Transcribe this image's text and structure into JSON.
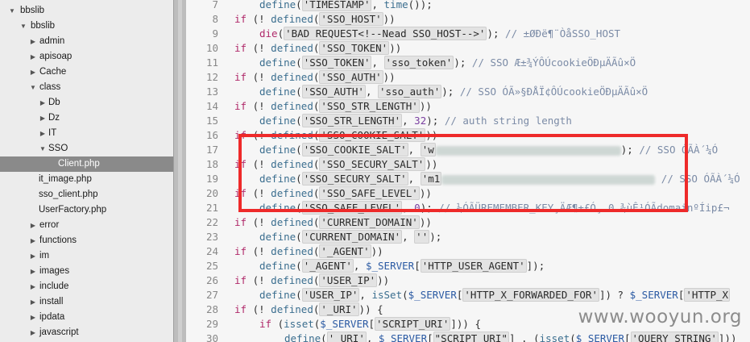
{
  "tree": [
    {
      "label": "bbslib",
      "level": 0,
      "expanded": true
    },
    {
      "label": "bbslib",
      "level": 1,
      "expanded": true
    },
    {
      "label": "admin",
      "level": 2,
      "expanded": false
    },
    {
      "label": "apisoap",
      "level": 2,
      "expanded": false
    },
    {
      "label": "Cache",
      "level": 2,
      "expanded": false
    },
    {
      "label": "class",
      "level": 2,
      "expanded": true
    },
    {
      "label": "Db",
      "level": 3,
      "expanded": false
    },
    {
      "label": "Dz",
      "level": 3,
      "expanded": false
    },
    {
      "label": "IT",
      "level": 3,
      "expanded": false
    },
    {
      "label": "SSO",
      "level": 3,
      "expanded": true
    },
    {
      "label": "Client.php",
      "level": 4,
      "file": true,
      "selected": true
    },
    {
      "label": "it_image.php",
      "level": 3,
      "file": true
    },
    {
      "label": "sso_client.php",
      "level": 3,
      "file": true
    },
    {
      "label": "UserFactory.php",
      "level": 3,
      "file": true
    },
    {
      "label": "error",
      "level": 2,
      "expanded": false
    },
    {
      "label": "functions",
      "level": 2,
      "expanded": false
    },
    {
      "label": "im",
      "level": 2,
      "expanded": false
    },
    {
      "label": "images",
      "level": 2,
      "expanded": false
    },
    {
      "label": "include",
      "level": 2,
      "expanded": false
    },
    {
      "label": "install",
      "level": 2,
      "expanded": false
    },
    {
      "label": "ipdata",
      "level": 2,
      "expanded": false
    },
    {
      "label": "javascript",
      "level": 2,
      "expanded": false
    }
  ],
  "code": [
    {
      "n": "7",
      "indent": 1,
      "tokens": [
        [
          "fn",
          "define"
        ],
        [
          "plain",
          "("
        ],
        [
          "str",
          "'TIMESTAMP'"
        ],
        [
          "plain",
          ", "
        ],
        [
          "fn",
          "time"
        ],
        [
          "plain",
          "());"
        ]
      ]
    },
    {
      "n": "8",
      "indent": 0,
      "tokens": [
        [
          "kw",
          "if"
        ],
        [
          "plain",
          " (! "
        ],
        [
          "fn",
          "defined"
        ],
        [
          "plain",
          "("
        ],
        [
          "str",
          "'SSO_HOST'"
        ],
        [
          "plain",
          "))"
        ]
      ]
    },
    {
      "n": "9",
      "indent": 1,
      "tokens": [
        [
          "kw",
          "die"
        ],
        [
          "plain",
          "("
        ],
        [
          "str",
          "'BAD REQUEST<!--Nead SSO_HOST-->'"
        ],
        [
          "plain",
          "); "
        ],
        [
          "cmt",
          "// ±ØÐë¶¨ÒåSSO_HOST"
        ]
      ]
    },
    {
      "n": "10",
      "indent": 0,
      "tokens": [
        [
          "kw",
          "if"
        ],
        [
          "plain",
          " (! "
        ],
        [
          "fn",
          "defined"
        ],
        [
          "plain",
          "("
        ],
        [
          "str",
          "'SSO_TOKEN'"
        ],
        [
          "plain",
          "))"
        ]
      ]
    },
    {
      "n": "11",
      "indent": 1,
      "tokens": [
        [
          "fn",
          "define"
        ],
        [
          "plain",
          "("
        ],
        [
          "str",
          "'SSO_TOKEN'"
        ],
        [
          "plain",
          ", "
        ],
        [
          "str",
          "'sso_token'"
        ],
        [
          "plain",
          "); "
        ],
        [
          "cmt",
          "// SSO Æ±¾ÝÔÚcookieÖÐµÄÃû×Ö"
        ]
      ]
    },
    {
      "n": "12",
      "indent": 0,
      "tokens": [
        [
          "kw",
          "if"
        ],
        [
          "plain",
          " (! "
        ],
        [
          "fn",
          "defined"
        ],
        [
          "plain",
          "("
        ],
        [
          "str",
          "'SSO_AUTH'"
        ],
        [
          "plain",
          "))"
        ]
      ]
    },
    {
      "n": "13",
      "indent": 1,
      "tokens": [
        [
          "fn",
          "define"
        ],
        [
          "plain",
          "("
        ],
        [
          "str",
          "'SSO_AUTH'"
        ],
        [
          "plain",
          ", "
        ],
        [
          "str",
          "'sso_auth'"
        ],
        [
          "plain",
          "); "
        ],
        [
          "cmt",
          "// SSO ÓÃ»§ÐÅÏ¢ÔÚcookieÖÐµÄÃû×Ö"
        ]
      ]
    },
    {
      "n": "14",
      "indent": 0,
      "tokens": [
        [
          "kw",
          "if"
        ],
        [
          "plain",
          " (! "
        ],
        [
          "fn",
          "defined"
        ],
        [
          "plain",
          "("
        ],
        [
          "str",
          "'SSO_STR_LENGTH'"
        ],
        [
          "plain",
          "))"
        ]
      ]
    },
    {
      "n": "15",
      "indent": 1,
      "tokens": [
        [
          "fn",
          "define"
        ],
        [
          "plain",
          "("
        ],
        [
          "str",
          "'SSO_STR_LENGTH'"
        ],
        [
          "plain",
          ", "
        ],
        [
          "num",
          "32"
        ],
        [
          "plain",
          "); "
        ],
        [
          "cmt",
          "// auth string length"
        ]
      ]
    },
    {
      "n": "16",
      "indent": 0,
      "tokens": [
        [
          "kw",
          "if"
        ],
        [
          "plain",
          " (! "
        ],
        [
          "fn",
          "defined"
        ],
        [
          "plain",
          "("
        ],
        [
          "str",
          "'SSO_COOKIE_SALT'"
        ],
        [
          "plain",
          "))"
        ]
      ]
    },
    {
      "n": "17",
      "indent": 1,
      "tokens": [
        [
          "fn",
          "define"
        ],
        [
          "plain",
          "("
        ],
        [
          "str",
          "'SSO_COOKIE_SALT'"
        ],
        [
          "plain",
          ", "
        ],
        [
          "str",
          "'w"
        ],
        [
          "blur",
          "230"
        ],
        [
          "plain",
          "); "
        ],
        [
          "cmt",
          "// SSO ÓÃÀ´¼Ó"
        ]
      ]
    },
    {
      "n": "18",
      "indent": 0,
      "tokens": [
        [
          "kw",
          "if"
        ],
        [
          "plain",
          " (! "
        ],
        [
          "fn",
          "defined"
        ],
        [
          "plain",
          "("
        ],
        [
          "str",
          "'SSO_SECURY_SALT'"
        ],
        [
          "plain",
          "))"
        ]
      ]
    },
    {
      "n": "19",
      "indent": 1,
      "tokens": [
        [
          "fn",
          "define"
        ],
        [
          "plain",
          "("
        ],
        [
          "str",
          "'SSO_SECURY_SALT'"
        ],
        [
          "plain",
          ", "
        ],
        [
          "str",
          "'m1"
        ],
        [
          "blur",
          "265"
        ],
        [
          "plain",
          " "
        ],
        [
          "cmt",
          "// SSO ÓÃÀ´¼Ó"
        ]
      ]
    },
    {
      "n": "20",
      "indent": 0,
      "tokens": [
        [
          "kw",
          "if"
        ],
        [
          "plain",
          " (! "
        ],
        [
          "fn",
          "defined"
        ],
        [
          "plain",
          "("
        ],
        [
          "str",
          "'SSO_SAFE_LEVEL'"
        ],
        [
          "plain",
          "))"
        ]
      ]
    },
    {
      "n": "21",
      "indent": 1,
      "tokens": [
        [
          "fn",
          "define"
        ],
        [
          "plain",
          "("
        ],
        [
          "str",
          "'SSO_SAFE_LEVEL'"
        ],
        [
          "plain",
          ", "
        ],
        [
          "num",
          "0"
        ],
        [
          "plain",
          "); "
        ],
        [
          "cmt",
          "// ¼ÓÃÜREMEMBER_KEY¸ÄÆ¶±£Ó¸ 0 ¾ùÊ¹ÓÃdomainºÍip£¬"
        ]
      ]
    },
    {
      "n": "22",
      "indent": 0,
      "tokens": [
        [
          "kw",
          "if"
        ],
        [
          "plain",
          " (! "
        ],
        [
          "fn",
          "defined"
        ],
        [
          "plain",
          "("
        ],
        [
          "str",
          "'CURRENT_DOMAIN'"
        ],
        [
          "plain",
          "))"
        ]
      ]
    },
    {
      "n": "23",
      "indent": 1,
      "tokens": [
        [
          "fn",
          "define"
        ],
        [
          "plain",
          "("
        ],
        [
          "str",
          "'CURRENT_DOMAIN'"
        ],
        [
          "plain",
          ", "
        ],
        [
          "str",
          "''"
        ],
        [
          "plain",
          ");"
        ]
      ]
    },
    {
      "n": "24",
      "indent": 0,
      "tokens": [
        [
          "kw",
          "if"
        ],
        [
          "plain",
          " (! "
        ],
        [
          "fn",
          "defined"
        ],
        [
          "plain",
          "("
        ],
        [
          "str",
          "'_AGENT'"
        ],
        [
          "plain",
          "))"
        ]
      ]
    },
    {
      "n": "25",
      "indent": 1,
      "tokens": [
        [
          "fn",
          "define"
        ],
        [
          "plain",
          "("
        ],
        [
          "str",
          "'_AGENT'"
        ],
        [
          "plain",
          ", "
        ],
        [
          "var",
          "$_SERVER"
        ],
        [
          "plain",
          "["
        ],
        [
          "str",
          "'HTTP_USER_AGENT'"
        ],
        [
          "plain",
          "]);"
        ]
      ]
    },
    {
      "n": "26",
      "indent": 0,
      "tokens": [
        [
          "kw",
          "if"
        ],
        [
          "plain",
          " (! "
        ],
        [
          "fn",
          "defined"
        ],
        [
          "plain",
          "("
        ],
        [
          "str",
          "'USER_IP'"
        ],
        [
          "plain",
          "))"
        ]
      ]
    },
    {
      "n": "27",
      "indent": 1,
      "tokens": [
        [
          "fn",
          "define"
        ],
        [
          "plain",
          "("
        ],
        [
          "str",
          "'USER_IP'"
        ],
        [
          "plain",
          ", "
        ],
        [
          "fn",
          "isSet"
        ],
        [
          "plain",
          "("
        ],
        [
          "var",
          "$_SERVER"
        ],
        [
          "plain",
          "["
        ],
        [
          "str",
          "'HTTP_X_FORWARDED_FOR'"
        ],
        [
          "plain",
          "]) ? "
        ],
        [
          "var",
          "$_SERVER"
        ],
        [
          "plain",
          "["
        ],
        [
          "str",
          "'HTTP_X"
        ]
      ]
    },
    {
      "n": "28",
      "indent": 0,
      "tokens": [
        [
          "kw",
          "if"
        ],
        [
          "plain",
          " (! "
        ],
        [
          "fn",
          "defined"
        ],
        [
          "plain",
          "("
        ],
        [
          "str",
          "'_URI'"
        ],
        [
          "plain",
          ")) {"
        ]
      ]
    },
    {
      "n": "29",
      "indent": 1,
      "tokens": [
        [
          "kw",
          "if"
        ],
        [
          "plain",
          " ("
        ],
        [
          "fn",
          "isset"
        ],
        [
          "plain",
          "("
        ],
        [
          "var",
          "$_SERVER"
        ],
        [
          "plain",
          "["
        ],
        [
          "str",
          "'SCRIPT_URI'"
        ],
        [
          "plain",
          "])) {"
        ]
      ]
    },
    {
      "n": "30",
      "indent": 2,
      "tokens": [
        [
          "fn",
          "define"
        ],
        [
          "plain",
          "("
        ],
        [
          "str",
          "'_URI'"
        ],
        [
          "plain",
          ", "
        ],
        [
          "var",
          "$_SERVER"
        ],
        [
          "plain",
          "["
        ],
        [
          "str",
          "\"SCRIPT_URI\""
        ],
        [
          "plain",
          "] . ("
        ],
        [
          "fn",
          "isset"
        ],
        [
          "plain",
          "("
        ],
        [
          "var",
          "$_SERVER"
        ],
        [
          "plain",
          "["
        ],
        [
          "str",
          "'QUERY_STRING'"
        ],
        [
          "plain",
          "]))"
        ]
      ]
    }
  ],
  "watermark": "www.wooyun.org",
  "colors": {
    "highlight_box": "#ee2a2a",
    "keyword": "#b0296a",
    "selected_row": "#8a8a8a"
  }
}
